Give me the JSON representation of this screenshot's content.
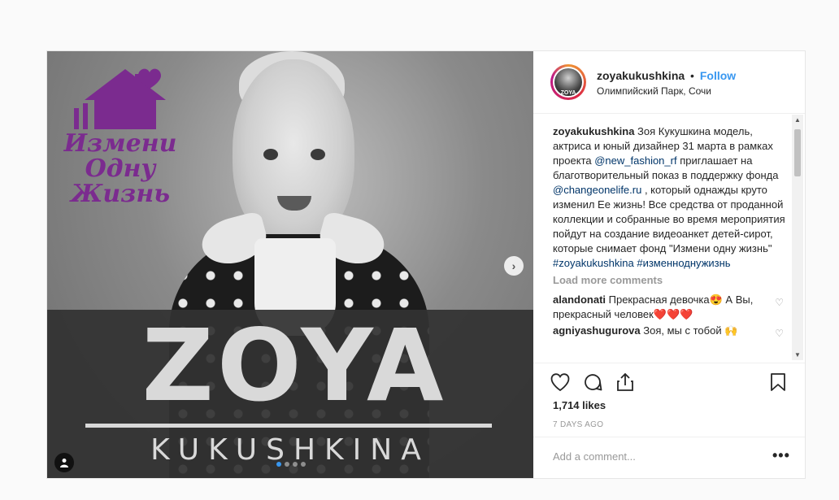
{
  "post": {
    "image": {
      "logo_text_line1": "Измени",
      "logo_text_line2": "Одну",
      "logo_text_line3": "Жизнь",
      "title": "ZOYA",
      "subtitle": "KUKUSHKINA",
      "next_icon": "chevron-right-icon",
      "tag_icon": "user-tag-icon",
      "carousel_dots": 4,
      "carousel_active": 0
    },
    "header": {
      "username": "zoyakukushkina",
      "separator": "•",
      "follow_label": "Follow",
      "location": "Олимпийский Парк, Сочи",
      "avatar_label": "ZOYA"
    },
    "caption": {
      "username": "zoyakukushkina",
      "text_1": " Зоя Кукушкина модель, актриса и юный дизайнер 31 марта в рамках проекта ",
      "mention_1": "@new_fashion_rf",
      "text_2": " приглашает на благотворительный показ в поддержку фонда ",
      "mention_2": "@changeonelife.ru",
      "text_3": " , который однажды круто изменил Ее жизнь! Все средства от проданной коллекции и собранные во время мероприятия пойдут на создание видеоанкет детей-сирот, которые снимает фонд \"Измени одну жизнь\" ",
      "hashtag_1": "#zoyakukushkina",
      "hashtag_2": "#изменноднужизнь"
    },
    "load_more_label": "Load more comments",
    "comments": [
      {
        "username": "alandonati",
        "text": " Прекрасная девочка😍 А Вы, прекрасный человек❤️❤️❤️"
      },
      {
        "username": "agniyashugurova",
        "text": " Зоя, мы с тобой 🙌"
      }
    ],
    "likes": "1,714 likes",
    "time_ago": "7 DAYS AGO",
    "add_comment_placeholder": "Add a comment...",
    "more_label": "•••",
    "colors": {
      "accent": "#3897f0",
      "link": "#003569",
      "logo_purple": "#7b2b8f"
    }
  }
}
